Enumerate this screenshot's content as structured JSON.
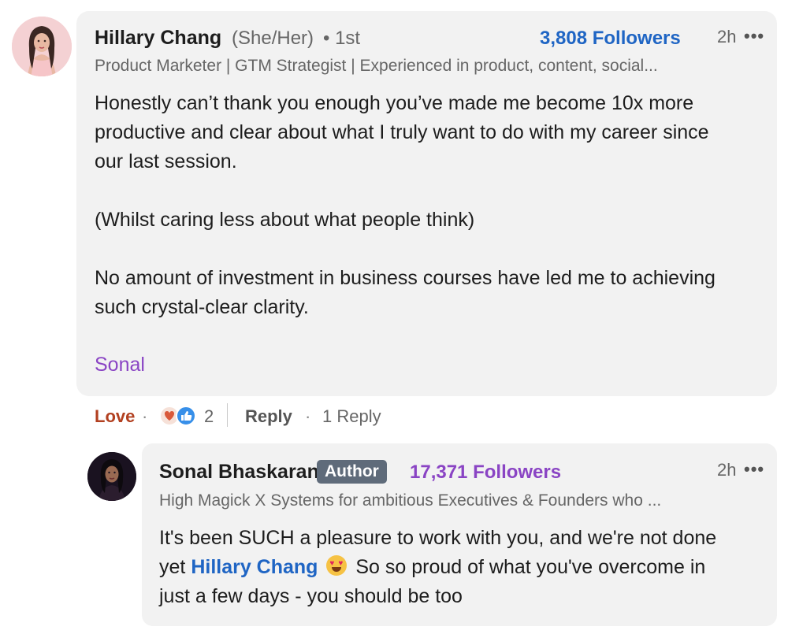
{
  "main_comment": {
    "author": "Hillary Chang",
    "pronouns": "(She/Her)",
    "connection": "• 1st",
    "followers": "3,808 Followers",
    "time": "2h",
    "more": "•••",
    "headline": "Product Marketer | GTM Strategist | Experienced in product, content, social...",
    "paragraphs": [
      "Honestly can’t thank you enough you’ve made me become 10x more",
      "productive and clear about what I truly want to do with my career since",
      "our last session.",
      "(Whilst caring less about what people think)",
      "No amount of investment in business courses have led me to achieving",
      "such crystal-clear clarity."
    ],
    "mention": "Sonal"
  },
  "actions": {
    "reaction_label": "Love",
    "sep": "·",
    "reaction_count": "2",
    "reply_label": "Reply",
    "reply_count": "1 Reply"
  },
  "reply_comment": {
    "author": "Sonal Bhaskaran",
    "badge": "Author",
    "followers": "17,371 Followers",
    "time": "2h",
    "more": "•••",
    "headline": "High Magick X Systems for ambitious Executives & Founders who ...",
    "line1": "It's been SUCH a pleasure to work with you, and we're not done",
    "line2_prefix": "yet",
    "line2_mention": "Hillary Chang",
    "line2_suffix": "So so proud of what you've overcome in",
    "line3": "just a few days - you should be too"
  },
  "colors": {
    "followers_blue": "#1f65c4",
    "followers_purple": "#8a44c4",
    "love_red": "#b24020"
  },
  "icons": [
    "more-icon",
    "love-reaction-icon",
    "like-reaction-icon",
    "heart-eyes-emoji-icon"
  ]
}
